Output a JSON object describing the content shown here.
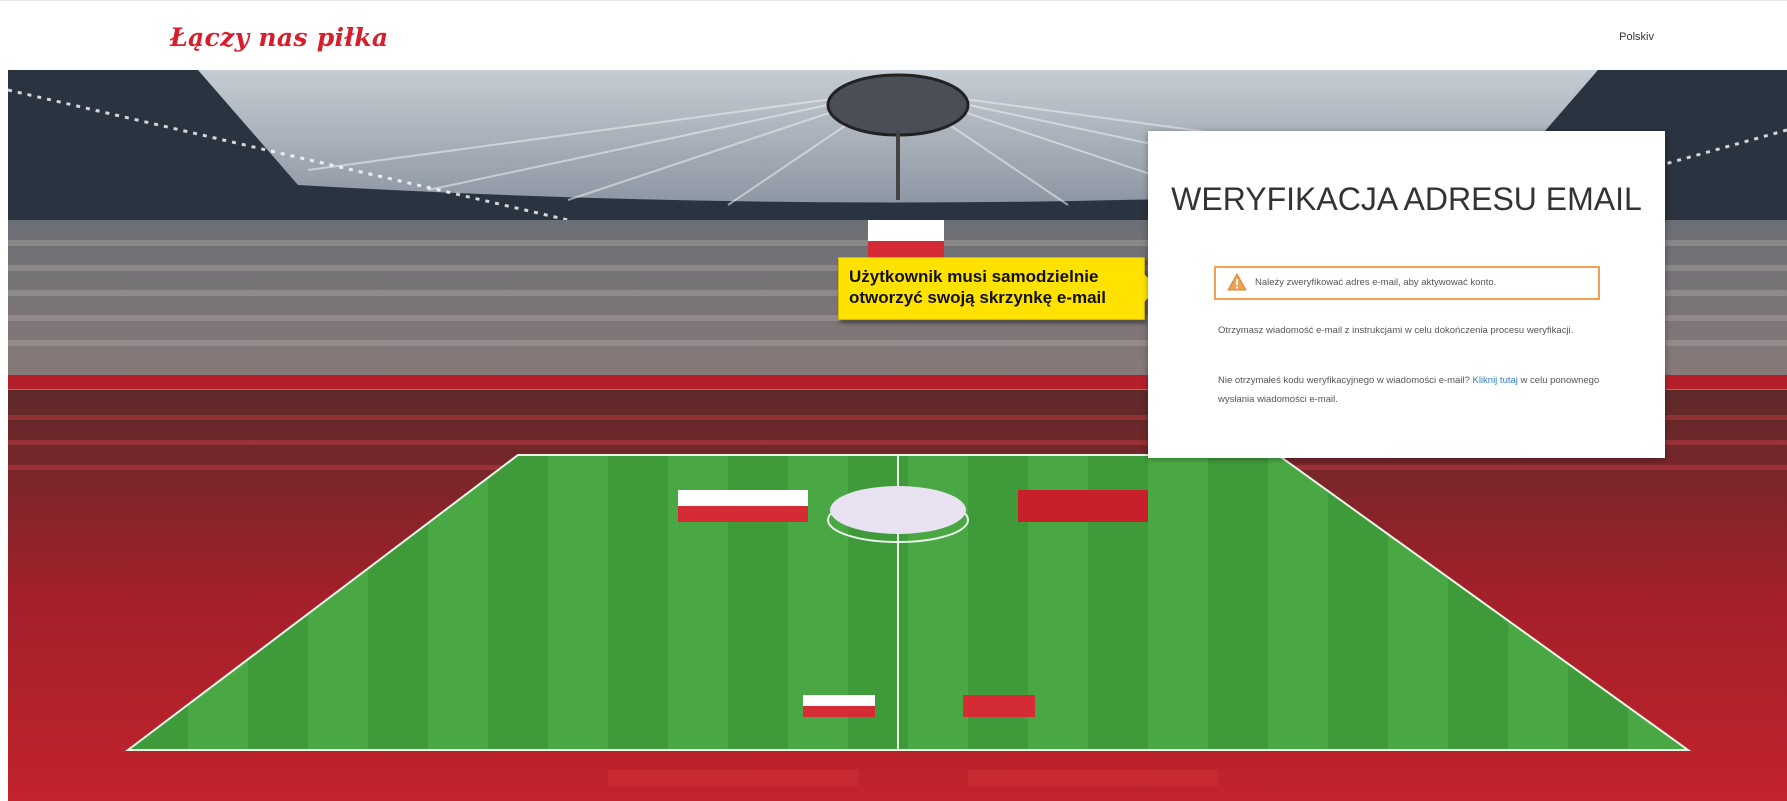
{
  "header": {
    "logo_text": "Łączy nas piłka",
    "language": "Polskiv"
  },
  "callout": {
    "text": "Użytkownik musi samodzielnie otworzyć swoją skrzynkę e-mail"
  },
  "card": {
    "title": "WERYFIKACJA ADRESU EMAIL",
    "warning": "Należy zweryfikować adres e-mail, aby aktywować konto.",
    "info": "Otrzymasz wiadomość e-mail z instrukcjami w celu dokończenia procesu weryfikacji.",
    "resend_prefix": "Nie otrzymałeś kodu weryfikacyjnego w wiadomości e-mail?",
    "resend_link": "Kliknij tutaj",
    "resend_suffix": "w celu ponownego wysłania wiadomości e-mail."
  },
  "colors": {
    "logo_red": "#d81e2c",
    "warning_border": "#f0a050",
    "callout_yellow": "#ffe200",
    "link_blue": "#2f80c8"
  }
}
